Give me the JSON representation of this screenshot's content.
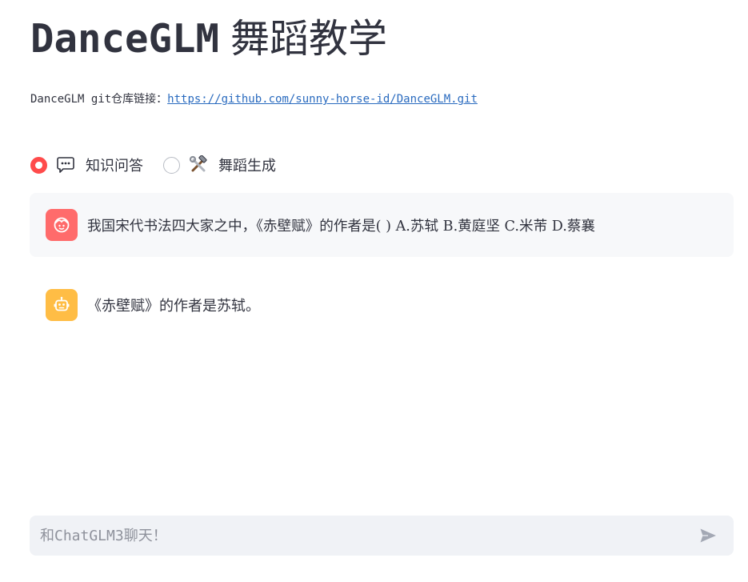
{
  "header": {
    "title_en": "DanceGLM",
    "title_zh": "舞蹈教学"
  },
  "repo": {
    "label": "DanceGLM git仓库链接：",
    "link_text": "https://github.com/sunny-horse-id/DanceGLM.git"
  },
  "mode_selector": {
    "options": [
      {
        "label": "知识问答",
        "icon": "speech-bubble-icon",
        "selected": true
      },
      {
        "label": "舞蹈生成",
        "icon": "hammer-wrench-icon",
        "selected": false
      }
    ]
  },
  "chat": {
    "messages": [
      {
        "role": "user",
        "avatar_icon": "user-face-icon",
        "text": "我国宋代书法四大家之中，《赤壁赋》的作者是( ) A.苏轼 B.黄庭坚 C.米芾 D.蔡襄"
      },
      {
        "role": "assistant",
        "avatar_icon": "robot-face-icon",
        "text": "《赤壁赋》的作者是苏轼。"
      }
    ]
  },
  "input": {
    "placeholder": "和ChatGLM3聊天！",
    "value": ""
  },
  "colors": {
    "accent": "#ff4b4b",
    "user_avatar": "#ff6b6b",
    "bot_avatar": "#ffbd45",
    "link": "#2a6bbf"
  }
}
